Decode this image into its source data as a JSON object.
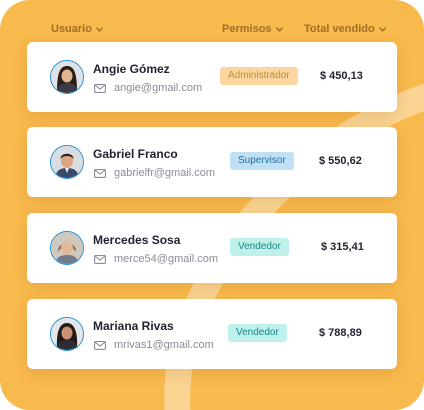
{
  "colors": {
    "background": "#f8b94d",
    "header_text": "#a06f26",
    "swoosh": "#fbd493",
    "admin_badge": "#fbd79f",
    "supervisor_badge": "#bfe0f5",
    "vendedor_badge": "#bff0ec"
  },
  "headers": {
    "usuario": "Usuario",
    "permisos": "Permisos",
    "total": "Total vendido",
    "sort_icon": "chevron-down-icon"
  },
  "rows": [
    {
      "name": "Angie Gómez",
      "email": "angie@gmail.com",
      "role": "Administrador",
      "total": "$ 450,13",
      "avatar": "woman-long-dark-hair"
    },
    {
      "name": "Gabriel Franco",
      "email": "gabrielfr@gmail.com",
      "role": "Supervisor",
      "total": "$ 550,62",
      "avatar": "man-short-dark-hair"
    },
    {
      "name": "Mercedes Sosa",
      "email": "merce54@gmail.com",
      "role": "Vendedor",
      "total": "$ 315,41",
      "avatar": "older-woman-light-hair"
    },
    {
      "name": "Mariana Rivas",
      "email": "mrivas1@gmail.com",
      "role": "Vendedor",
      "total": "$ 788,89",
      "avatar": "woman-dark-hair"
    }
  ]
}
